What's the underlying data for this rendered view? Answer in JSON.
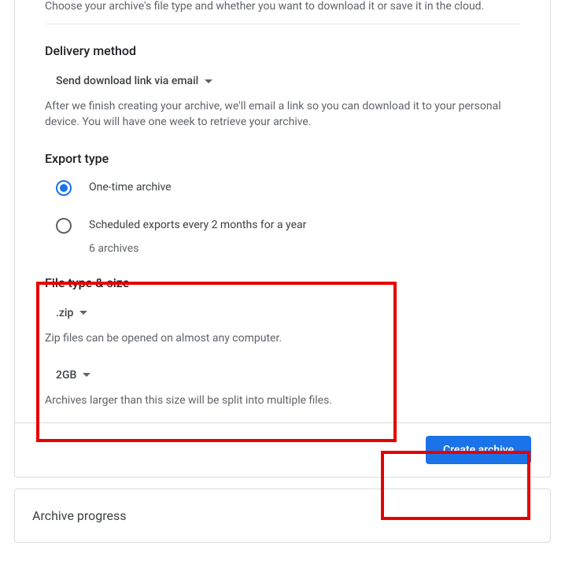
{
  "intro_text": "Choose your archive's file type and whether you want to download it or save it in the cloud.",
  "delivery": {
    "title": "Delivery method",
    "selected": "Send download link via email",
    "help": "After we finish creating your archive, we'll email a link so you can download it to your personal device. You will have one week to retrieve your archive."
  },
  "export_type": {
    "title": "Export type",
    "options": [
      {
        "label": "One-time archive",
        "sub": "",
        "selected": true
      },
      {
        "label": "Scheduled exports every 2 months for a year",
        "sub": "6 archives",
        "selected": false
      }
    ]
  },
  "filetype": {
    "title": "File type & size",
    "type_selected": ".zip",
    "type_help": "Zip files can be opened on almost any computer.",
    "size_selected": "2GB",
    "size_help": "Archives larger than this size will be split into multiple files."
  },
  "create_button": "Create archive",
  "progress": {
    "title": "Archive progress"
  }
}
